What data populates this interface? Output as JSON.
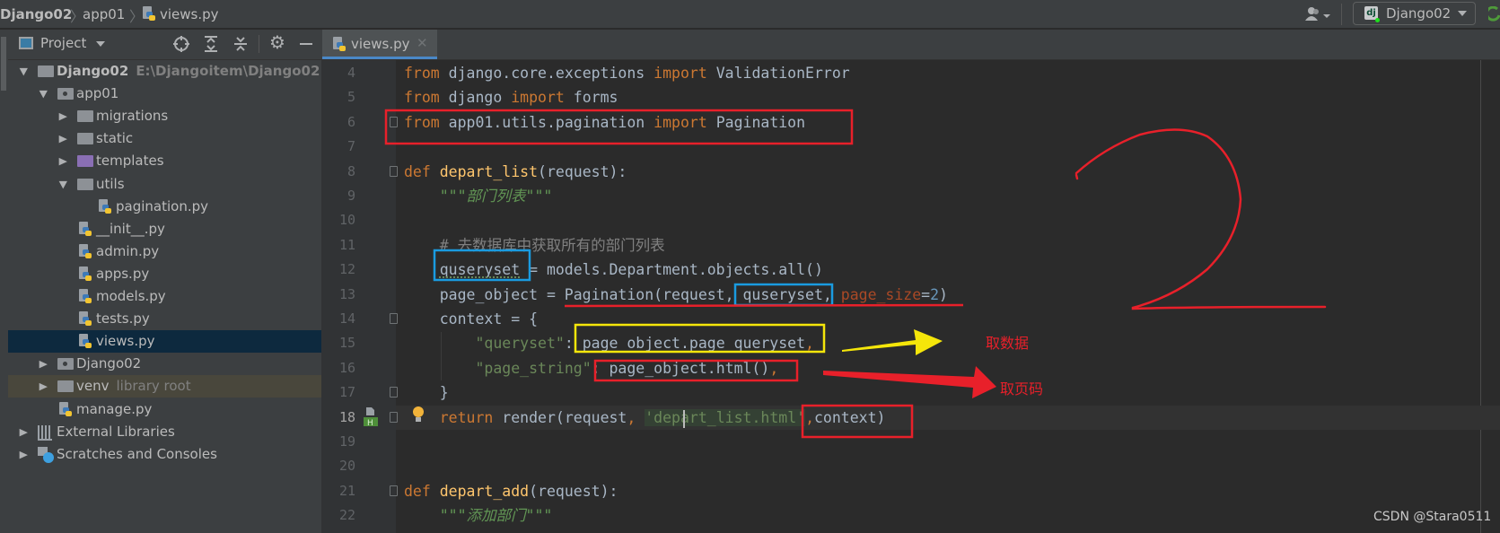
{
  "breadcrumb": {
    "project": "Django02",
    "folder": "app01",
    "file": "views.py"
  },
  "toolbar": {
    "run_config": "Django02",
    "run_config_icon": "dj"
  },
  "sidebar": {
    "title": "Project",
    "tree": [
      {
        "label": "Django02",
        "extra": "E:\\Djangoitem\\Django02",
        "depth": 0,
        "type": "folder",
        "arrow": "down",
        "bold": true
      },
      {
        "label": "app01",
        "depth": 1,
        "type": "package",
        "arrow": "down"
      },
      {
        "label": "migrations",
        "depth": 2,
        "type": "folder",
        "arrow": "right"
      },
      {
        "label": "static",
        "depth": 2,
        "type": "folder",
        "arrow": "right"
      },
      {
        "label": "templates",
        "depth": 2,
        "type": "folder-purple",
        "arrow": "right"
      },
      {
        "label": "utils",
        "depth": 2,
        "type": "folder",
        "arrow": "down"
      },
      {
        "label": "pagination.py",
        "depth": 3,
        "type": "python"
      },
      {
        "label": "__init__.py",
        "depth": 2,
        "type": "python"
      },
      {
        "label": "admin.py",
        "depth": 2,
        "type": "python"
      },
      {
        "label": "apps.py",
        "depth": 2,
        "type": "python"
      },
      {
        "label": "models.py",
        "depth": 2,
        "type": "python"
      },
      {
        "label": "tests.py",
        "depth": 2,
        "type": "python"
      },
      {
        "label": "views.py",
        "depth": 2,
        "type": "python",
        "selected": true
      },
      {
        "label": "Django02",
        "depth": 1,
        "type": "package",
        "arrow": "right"
      },
      {
        "label": "venv",
        "extra": "library root",
        "depth": 1,
        "type": "folder",
        "arrow": "right",
        "library": true
      },
      {
        "label": "manage.py",
        "depth": 1,
        "type": "python"
      },
      {
        "label": "External Libraries",
        "depth": 0,
        "type": "libraries",
        "arrow": "right"
      },
      {
        "label": "Scratches and Consoles",
        "depth": 0,
        "type": "scratches",
        "arrow": "right"
      }
    ]
  },
  "tabs": [
    {
      "label": "views.py",
      "active": true
    }
  ],
  "editor": {
    "current_line": 18,
    "lines": [
      {
        "n": "4",
        "tokens": [
          [
            "kw",
            "from"
          ],
          [
            "def",
            " django.core.exceptions "
          ],
          [
            "kw",
            "import"
          ],
          [
            "def",
            " ValidationError"
          ]
        ]
      },
      {
        "n": "5",
        "tokens": [
          [
            "kw",
            "from"
          ],
          [
            "def",
            " django "
          ],
          [
            "kw",
            "import"
          ],
          [
            "def",
            " forms"
          ]
        ]
      },
      {
        "n": "6",
        "tokens": [
          [
            "kw",
            "from"
          ],
          [
            "def",
            " app01.utils.pagination "
          ],
          [
            "kw",
            "import"
          ],
          [
            "def",
            " Pagination"
          ]
        ]
      },
      {
        "n": "7",
        "tokens": []
      },
      {
        "n": "8",
        "tokens": [
          [
            "kw",
            "def"
          ],
          [
            "fn",
            " depart_list"
          ],
          [
            "def",
            "(request):"
          ]
        ]
      },
      {
        "n": "9",
        "tokens": [
          [
            "def",
            "    "
          ],
          [
            "doc",
            "\"\"\"部门列表\"\"\""
          ]
        ]
      },
      {
        "n": "10",
        "tokens": []
      },
      {
        "n": "11",
        "tokens": [
          [
            "def",
            "    "
          ],
          [
            "cmt",
            "# 去数据库中获取所有的部门列表"
          ]
        ]
      },
      {
        "n": "12",
        "tokens": [
          [
            "def",
            "    quseryset = models.Department.objects.all()"
          ]
        ]
      },
      {
        "n": "13",
        "tokens": [
          [
            "def",
            "    page_object = Pagination(request, quseryset, "
          ],
          [
            "kwarg",
            "page_size"
          ],
          [
            "def",
            "="
          ],
          [
            "num",
            "2"
          ],
          [
            "def",
            ")"
          ]
        ]
      },
      {
        "n": "14",
        "tokens": [
          [
            "def",
            "    context = {"
          ]
        ]
      },
      {
        "n": "15",
        "tokens": [
          [
            "def",
            "        "
          ],
          [
            "str",
            "\"queryset\""
          ],
          [
            "def",
            ": page_object.page_queryset"
          ],
          [
            "kw",
            ","
          ]
        ]
      },
      {
        "n": "16",
        "tokens": [
          [
            "def",
            "        "
          ],
          [
            "str",
            "\"page_string\""
          ],
          [
            "def",
            ": page_object.html()"
          ],
          [
            "kw",
            ","
          ]
        ]
      },
      {
        "n": "17",
        "tokens": [
          [
            "def",
            "    }"
          ]
        ]
      },
      {
        "n": "18",
        "tokens": [
          [
            "def",
            "    "
          ],
          [
            "kw",
            "return"
          ],
          [
            "def",
            " render(request"
          ],
          [
            "kw",
            ","
          ],
          [
            "def",
            " "
          ],
          [
            "strhl",
            "'depart_list.html'"
          ],
          [
            "kw",
            ","
          ],
          [
            "def",
            "context)"
          ]
        ]
      },
      {
        "n": "19",
        "tokens": []
      },
      {
        "n": "20",
        "tokens": []
      },
      {
        "n": "21",
        "tokens": [
          [
            "kw",
            "def"
          ],
          [
            "fn",
            " depart_add"
          ],
          [
            "def",
            "(request):"
          ]
        ]
      },
      {
        "n": "22",
        "tokens": [
          [
            "def",
            "    "
          ],
          [
            "doc",
            "\"\"\"添加部门\"\"\""
          ]
        ]
      }
    ]
  },
  "annotations": {
    "get_data": "取数据",
    "get_page": "取页码",
    "handwritten_number": "2",
    "colors": {
      "red": "#e8202a",
      "blue": "#1a9be0",
      "yellow": "#f5e60a"
    }
  },
  "watermark": "CSDN @Stara0511"
}
